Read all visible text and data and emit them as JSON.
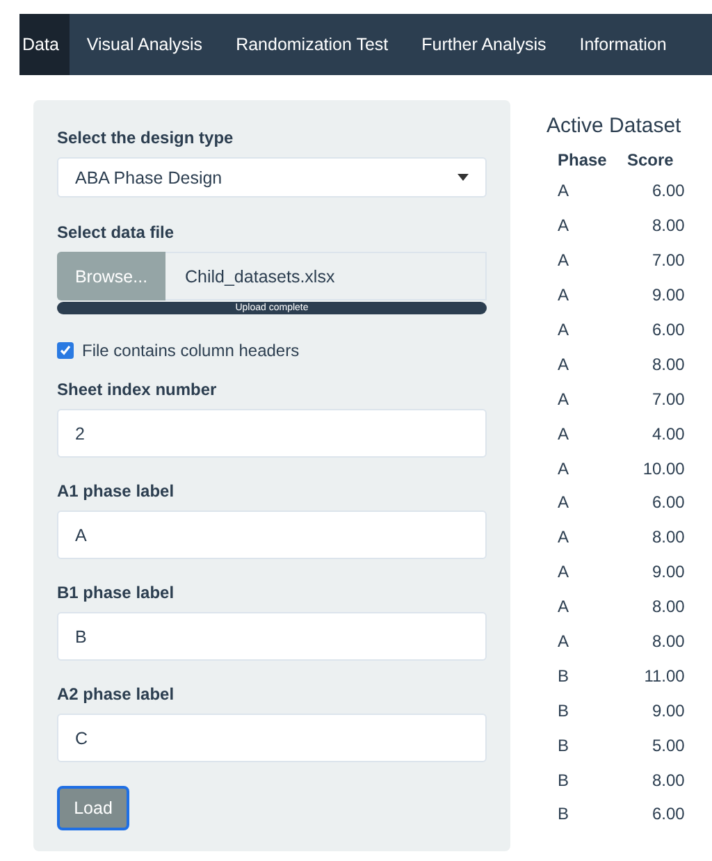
{
  "navbar": {
    "tabs": [
      {
        "label": "Data",
        "selected": true
      },
      {
        "label": "Visual Analysis",
        "selected": false
      },
      {
        "label": "Randomization Test",
        "selected": false
      },
      {
        "label": "Further Analysis",
        "selected": false
      },
      {
        "label": "Information",
        "selected": false
      }
    ]
  },
  "form": {
    "design_type": {
      "label": "Select the design type",
      "value": "ABA Phase Design"
    },
    "data_file": {
      "label": "Select data file",
      "button": "Browse...",
      "filename": "Child_datasets.xlsx",
      "progress_text": "Upload complete",
      "level": 1
    },
    "headers_checkbox": {
      "label": "File contains column headers",
      "checked": true
    },
    "fields": [
      {
        "label": "Sheet index number",
        "value": "2"
      },
      {
        "label": "A1 phase label",
        "value": "A"
      },
      {
        "label": "B1 phase label",
        "value": "B"
      },
      {
        "label": "A2 phase label",
        "value": "C"
      }
    ],
    "load_button": {
      "label": "Load",
      "focused": true
    }
  },
  "dataset": {
    "title": "Active Dataset",
    "columns": [
      "Phase",
      "Score"
    ],
    "rows": [
      [
        "A",
        "6.00"
      ],
      [
        "A",
        "8.00"
      ],
      [
        "A",
        "7.00"
      ],
      [
        "A",
        "9.00"
      ],
      [
        "A",
        "6.00"
      ],
      [
        "A",
        "8.00"
      ],
      [
        "A",
        "7.00"
      ],
      [
        "A",
        "4.00"
      ],
      [
        "A",
        "10.00"
      ],
      [
        "A",
        "6.00"
      ],
      [
        "A",
        "8.00"
      ],
      [
        "A",
        "9.00"
      ],
      [
        "A",
        "8.00"
      ],
      [
        "A",
        "8.00"
      ],
      [
        "B",
        "11.00"
      ],
      [
        "B",
        "9.00"
      ],
      [
        "B",
        "5.00"
      ],
      [
        "B",
        "8.00"
      ],
      [
        "B",
        "6.00"
      ]
    ]
  }
}
